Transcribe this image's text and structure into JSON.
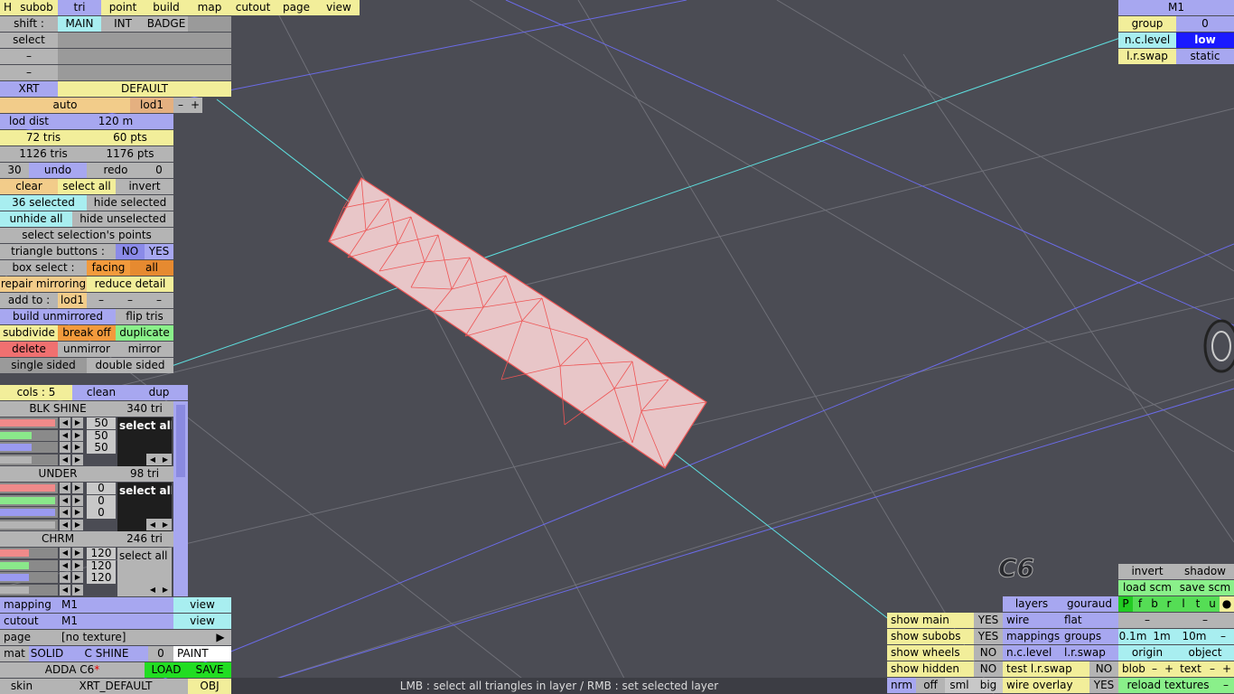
{
  "top_menu": {
    "h": "H",
    "subob": "subob",
    "tri": "tri",
    "point": "point",
    "build": "build",
    "map": "map",
    "cutout": "cutout",
    "page": "page",
    "view": "view"
  },
  "shift": {
    "label": "shift :",
    "main": "MAIN",
    "int": "INT",
    "badge": "BADGE"
  },
  "select_row": {
    "label": "select"
  },
  "dash": "–",
  "layer": {
    "xrt": "XRT",
    "default": "DEFAULT",
    "auto": "auto",
    "lod1": "lod1",
    "minus": "–",
    "plus": "+"
  },
  "lod": {
    "lod_dist": "lod dist",
    "dist_value": "120 m",
    "tris_a": "72 tris",
    "pts_a": "60 pts",
    "tris_b": "1126 tris",
    "pts_b": "1176 pts"
  },
  "undo": {
    "count": "30",
    "undo": "undo",
    "redo": "redo",
    "redo_count": "0"
  },
  "selection": {
    "clear": "clear",
    "select_all": "select all",
    "invert": "invert",
    "selected": "36 selected",
    "hide_selected": "hide selected",
    "unhide_all": "unhide all",
    "hide_unselected": "hide unselected",
    "select_points": "select selection's points"
  },
  "tri_buttons": {
    "label": "triangle buttons :",
    "no": "NO",
    "yes": "YES"
  },
  "box_select": {
    "label": "box select :",
    "facing": "facing",
    "all": "all"
  },
  "repair": {
    "repair_mirroring": "repair mirroring",
    "reduce_detail": "reduce detail"
  },
  "add_to": {
    "label": "add to :",
    "lod1": "lod1"
  },
  "build": {
    "build_unmirrored": "build unmirrored",
    "flip_tris": "flip tris",
    "subdivide": "subdivide",
    "break_off": "break off",
    "duplicate": "duplicate",
    "delete": "delete",
    "unmirror": "unmirror",
    "mirror": "mirror",
    "single_sided": "single sided",
    "double_sided": "double sided"
  },
  "cols": {
    "label": "cols : 5",
    "clean": "clean",
    "dup": "dup"
  },
  "materials": [
    {
      "name": "BLK SHINE",
      "tris": "340 tri",
      "values": [
        "50",
        "50",
        "50"
      ],
      "select_all": "select all",
      "r": 0.95,
      "g": 0.55,
      "b": 0.55,
      "a": 0.55
    },
    {
      "name": "UNDER",
      "tris": "98 tri",
      "values": [
        "0",
        "0",
        "0"
      ],
      "select_all": "select all",
      "r": 0.95,
      "g": 0.95,
      "b": 0.95,
      "a": 0.95
    },
    {
      "name": "CHRM",
      "tris": "246 tri",
      "values": [
        "120",
        "120",
        "120"
      ],
      "select_all": "select all",
      "r": 0.5,
      "g": 0.5,
      "b": 0.5,
      "a": 0.5
    }
  ],
  "bottom_left": {
    "mapping": "mapping",
    "mapping_val": "M1",
    "view": "view",
    "cutout": "cutout",
    "cutout_val": "M1",
    "page": "page",
    "page_val": "[no texture]",
    "play": "▶",
    "mat": "mat",
    "solid": "SOLID",
    "c_shine": "C SHINE",
    "zero": "0",
    "paint": "PAINT",
    "file": "ADDA C6",
    "star": "*",
    "load": "LOAD",
    "save": "SAVE",
    "skin": "skin",
    "skin_val": "XRT_DEFAULT",
    "obj": "OBJ"
  },
  "top_right": {
    "m1": "M1",
    "group": "group",
    "group_val": "0",
    "nc_level": "n.c.level",
    "nc_val": "low",
    "lr_swap": "l.r.swap",
    "lr_val": "static"
  },
  "bottom_right": {
    "invert": "invert",
    "shadow": "shadow",
    "load_scm": "load scm",
    "save_scm": "save scm",
    "layers": "layers",
    "gouraud": "gouraud",
    "letters": [
      "P",
      "f",
      "b",
      "r",
      "l",
      "t",
      "u",
      "●"
    ],
    "show_main": "show main",
    "show_main_v": "YES",
    "wire": "wire",
    "flat": "flat",
    "show_subobs": "show subobs",
    "show_subobs_v": "YES",
    "mappings": "mappings",
    "groups": "groups",
    "s01": "0.1m",
    "s1": "1m",
    "s10": "10m",
    "show_wheels": "show wheels",
    "show_wheels_v": "NO",
    "nc_level": "n.c.level",
    "lr_swap": "l.r.swap",
    "origin": "origin",
    "object": "object",
    "show_hidden": "show hidden",
    "show_hidden_v": "NO",
    "test_lr_swap": "test l.r.swap",
    "test_v": "NO",
    "blob": "blob",
    "text": "text",
    "nrm": "nrm",
    "off": "off",
    "sml": "sml",
    "big": "big",
    "wire_overlay": "wire overlay",
    "wire_overlay_v": "YES",
    "reload_textures": "reload textures"
  },
  "status": "LMB : select all triangles in layer / RMB : set selected layer",
  "watermark": "C6"
}
